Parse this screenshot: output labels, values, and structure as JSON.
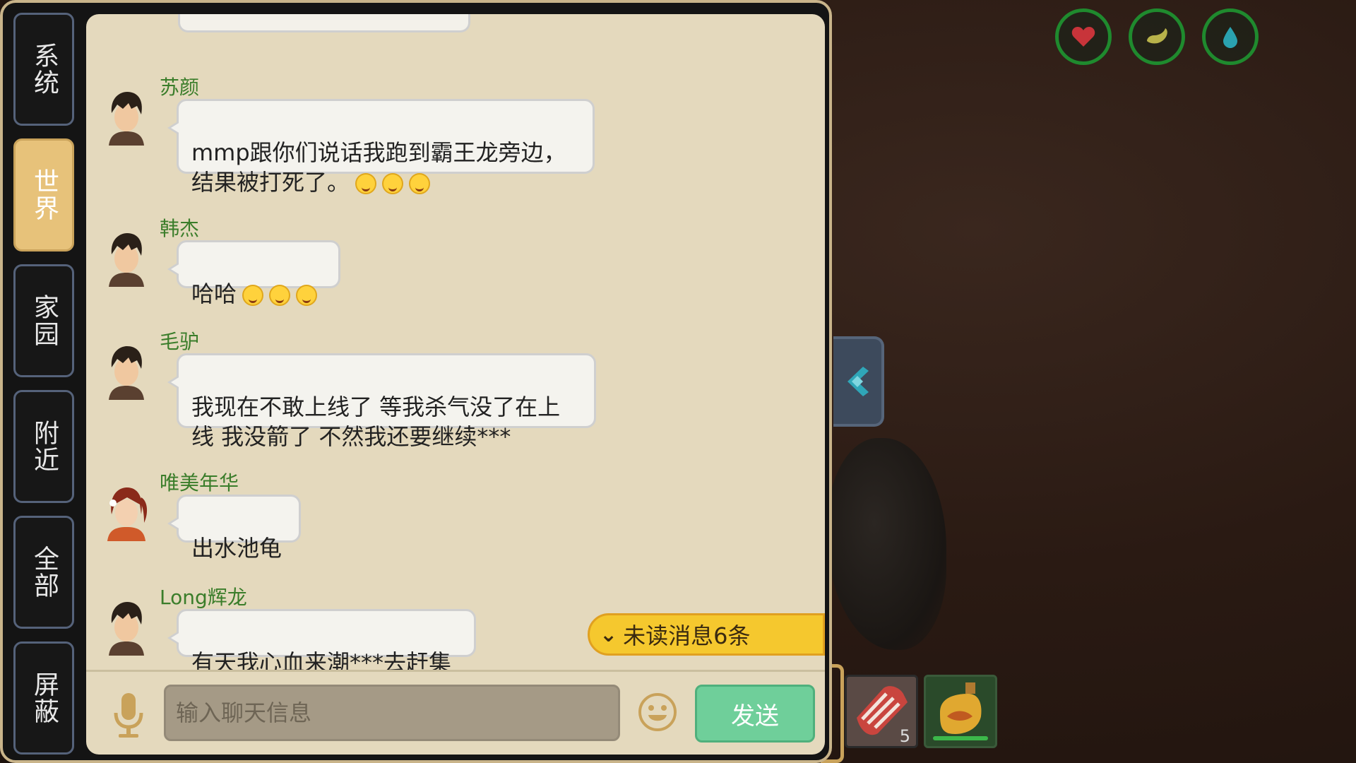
{
  "side_tabs": [
    {
      "label": "系统",
      "active": false
    },
    {
      "label": "世界",
      "active": true
    },
    {
      "label": "家园",
      "active": false
    },
    {
      "label": "附近",
      "active": false
    },
    {
      "label": "全部",
      "active": false
    },
    {
      "label": "屏蔽",
      "active": false
    }
  ],
  "messages": [
    {
      "sender": "苏颜",
      "text": "mmp跟你们说话我跑到霸王龙旁边，\n结果被打死了。",
      "emojis": 3
    },
    {
      "sender": "韩杰",
      "text": "哈哈",
      "emojis": 3
    },
    {
      "sender": "毛驴",
      "text": "我现在不敢上线了 等我杀气没了在上\n线  我没箭了 不然我还要继续***",
      "emojis": 0
    },
    {
      "sender": "唯美年华",
      "text": "出水池龟",
      "emojis": 0
    },
    {
      "sender": "Long辉龙",
      "text": "有天我心血来潮***去赶集",
      "emojis": 0
    }
  ],
  "unread": {
    "label": "未读消息6条"
  },
  "input": {
    "placeholder": "输入聊天信息",
    "value": ""
  },
  "send_label": "发送",
  "hotbar": {
    "meat_count": "5"
  },
  "status_icons": [
    "heart-icon",
    "hunger-icon",
    "water-drop-icon"
  ],
  "colors": {
    "sender": "#3a7d2a",
    "active_tab": "#e7c27a",
    "send": "#6fcf9a",
    "unread": "#f5c82e",
    "status_ring": "#1f8a2e"
  }
}
